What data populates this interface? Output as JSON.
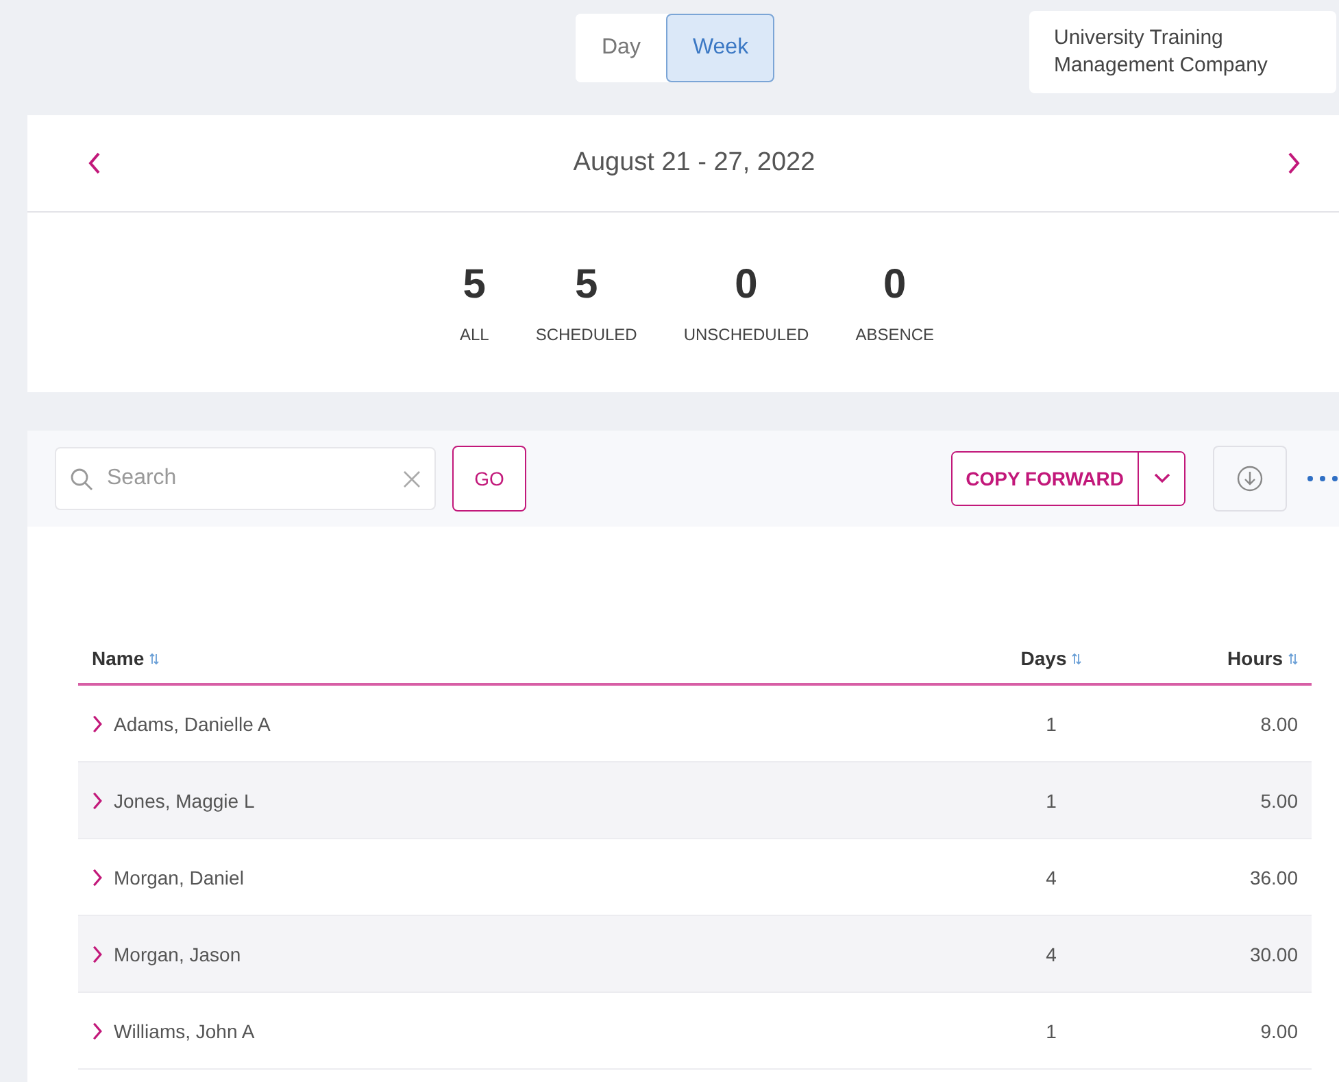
{
  "view_toggle": [
    {
      "label": "Day",
      "selected": false
    },
    {
      "label": "Week",
      "selected": true
    }
  ],
  "company": "University Training Management Company",
  "date_range": "August 21 - 27, 2022",
  "stats": [
    {
      "value": "5",
      "label": "ALL"
    },
    {
      "value": "5",
      "label": "SCHEDULED"
    },
    {
      "value": "0",
      "label": "UNSCHEDULED"
    },
    {
      "value": "0",
      "label": "ABSENCE"
    }
  ],
  "search": {
    "placeholder": "Search"
  },
  "go_button": "GO",
  "copy_forward_button": "COPY FORWARD",
  "table": {
    "columns": [
      "Name",
      "Days",
      "Hours"
    ],
    "rows": [
      {
        "name": "Adams, Danielle A",
        "days": "1",
        "hours": "8.00"
      },
      {
        "name": "Jones, Maggie L",
        "days": "1",
        "hours": "5.00"
      },
      {
        "name": "Morgan, Daniel",
        "days": "4",
        "hours": "36.00"
      },
      {
        "name": "Morgan, Jason",
        "days": "4",
        "hours": "30.00"
      },
      {
        "name": "Williams, John A",
        "days": "1",
        "hours": "9.00"
      }
    ]
  }
}
